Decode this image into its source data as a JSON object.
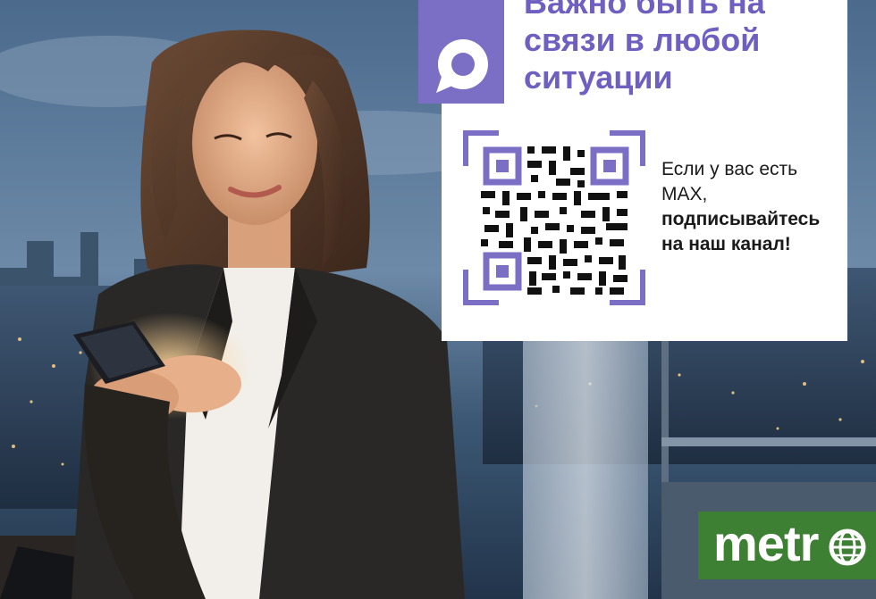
{
  "ad": {
    "headline": [
      "Важно быть на",
      "связи в любой",
      "ситуации"
    ],
    "promo_lines": [
      "Если у вас есть",
      "MAX,"
    ],
    "promo_bold_lines": [
      "подписывайтесь",
      "на наш канал!"
    ],
    "brand": "metr",
    "icons": {
      "messenger": "max-messenger-icon",
      "qr": "qr-code",
      "globe": "globe-icon"
    },
    "colors": {
      "accent": "#6f5fc0",
      "tile": "#7a6fc4",
      "brand_green": "#3d7f33",
      "card": "#ffffff"
    }
  }
}
